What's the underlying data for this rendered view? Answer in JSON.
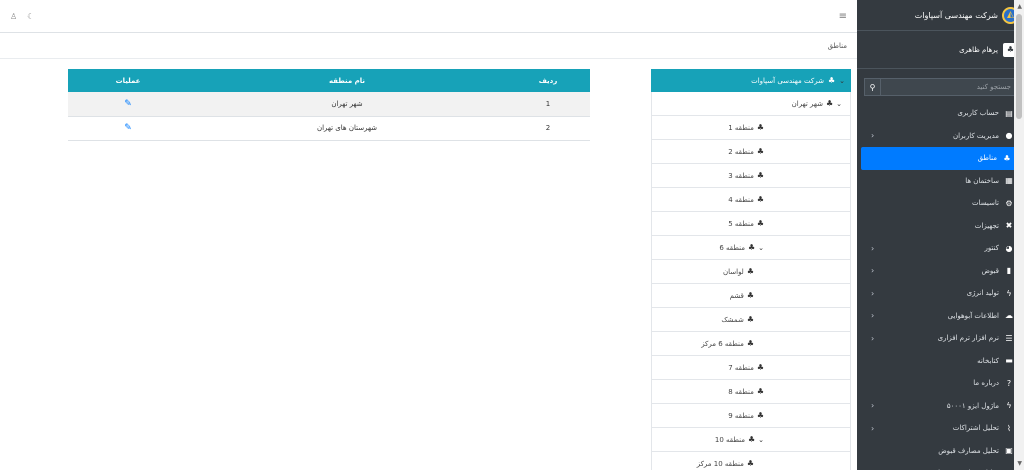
{
  "brand": {
    "title": "شرکت مهندسی آسپاوات"
  },
  "user": {
    "name": "پرهام ظاهری"
  },
  "search": {
    "placeholder": "جستجو کنید"
  },
  "menu": [
    {
      "label": "حساب کاربری",
      "icon": "id-card-icon",
      "glyph": "▤",
      "arrow": false,
      "active": false
    },
    {
      "label": "مدیریت کاربران",
      "icon": "user-icon",
      "glyph": "●",
      "arrow": true,
      "active": false
    },
    {
      "label": "مناطق",
      "icon": "sitemap-icon",
      "glyph": "♣",
      "arrow": false,
      "active": true
    },
    {
      "label": "ساختمان ها",
      "icon": "building-icon",
      "glyph": "▦",
      "arrow": false,
      "active": false
    },
    {
      "label": "تاسیسات",
      "icon": "cogs-icon",
      "glyph": "⚙",
      "arrow": false,
      "active": false
    },
    {
      "label": "تجهیزات",
      "icon": "tools-icon",
      "glyph": "✖",
      "arrow": false,
      "active": false
    },
    {
      "label": "کنتور",
      "icon": "gauge-icon",
      "glyph": "◕",
      "arrow": true,
      "active": false
    },
    {
      "label": "قبوض",
      "icon": "file-icon",
      "glyph": "▮",
      "arrow": true,
      "active": false
    },
    {
      "label": "تولید انرژی",
      "icon": "bolt-icon",
      "glyph": "ϟ",
      "arrow": true,
      "active": false
    },
    {
      "label": "اطلاعات آبوهوایی",
      "icon": "cloud-icon",
      "glyph": "☁",
      "arrow": true,
      "active": false
    },
    {
      "label": "نرم افزار ترم افزاری",
      "icon": "list-icon",
      "glyph": "☰",
      "arrow": true,
      "active": false
    },
    {
      "label": "کتابخانه",
      "icon": "book-icon",
      "glyph": "▬",
      "arrow": false,
      "active": false
    },
    {
      "label": "درباره ما",
      "icon": "question-icon",
      "glyph": "?",
      "arrow": false,
      "active": false
    },
    {
      "label": "ماژول ایزو ۵۰۰۰۱",
      "icon": "bolt-icon",
      "glyph": "ϟ",
      "arrow": true,
      "active": false
    },
    {
      "label": "تحلیل اشتراکات",
      "icon": "chart-icon",
      "glyph": "⌇",
      "arrow": true,
      "active": false
    },
    {
      "label": "تحلیل مصارف قبوض",
      "icon": "calculator-icon",
      "glyph": "▣",
      "arrow": false,
      "active": false
    },
    {
      "label": "تحلیل مصارف تجهیزات",
      "icon": "cogs-icon",
      "glyph": "⚙",
      "arrow": false,
      "active": false
    }
  ],
  "breadcrumb": "مناطق",
  "tree": {
    "root": "شرکت مهندسی آسپاوات",
    "nodes": [
      {
        "label": "شهر تهران",
        "level": 1,
        "caret": true
      },
      {
        "label": "منطقه 1",
        "level": 2,
        "caret": false
      },
      {
        "label": "منطقه 2",
        "level": 2,
        "caret": false
      },
      {
        "label": "منطقه 3",
        "level": 2,
        "caret": false
      },
      {
        "label": "منطقه 4",
        "level": 2,
        "caret": false
      },
      {
        "label": "منطقه 5",
        "level": 2,
        "caret": false
      },
      {
        "label": "منطقه 6",
        "level": 2,
        "caret": true
      },
      {
        "label": "لواسان",
        "level": 3,
        "caret": false
      },
      {
        "label": "قشم",
        "level": 3,
        "caret": false
      },
      {
        "label": "شمشک",
        "level": 3,
        "caret": false
      },
      {
        "label": "منطقه 6 مرکز",
        "level": 3,
        "caret": false
      },
      {
        "label": "منطقه 7",
        "level": 2,
        "caret": false
      },
      {
        "label": "منطقه 8",
        "level": 2,
        "caret": false
      },
      {
        "label": "منطقه 9",
        "level": 2,
        "caret": false
      },
      {
        "label": "منطقه 10",
        "level": 2,
        "caret": true
      },
      {
        "label": "منطقه 10 مرکز",
        "level": 3,
        "caret": false
      }
    ]
  },
  "table": {
    "headers": [
      "ردیف",
      "نام منطقه",
      "عملیات"
    ],
    "rows": [
      {
        "index": "1",
        "name": "شهر تهران"
      },
      {
        "index": "2",
        "name": "شهرستان های تهران"
      }
    ]
  }
}
